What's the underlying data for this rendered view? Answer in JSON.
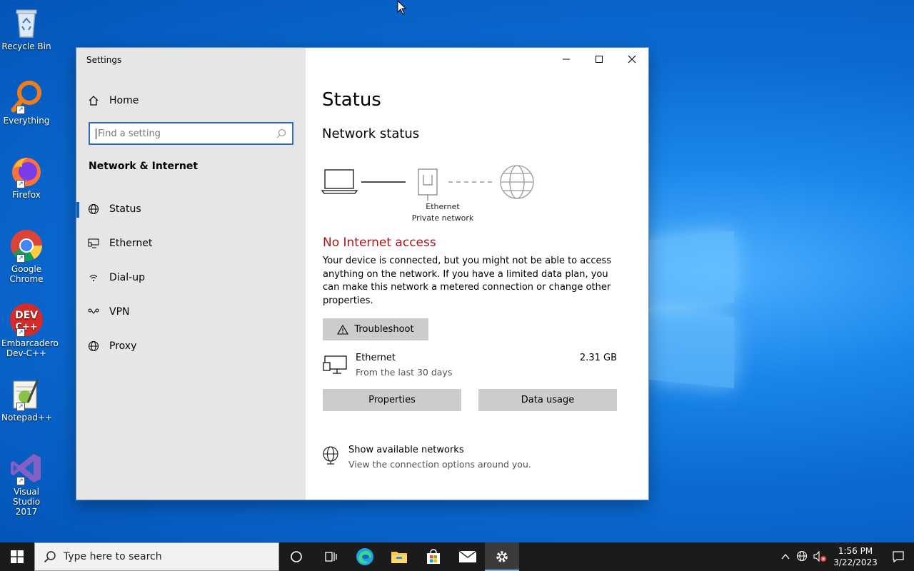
{
  "desktop": {
    "icons": [
      {
        "label": "Recycle Bin",
        "icon": "recycle-bin-icon"
      },
      {
        "label": "Everything",
        "icon": "everything-search-icon"
      },
      {
        "label": "Firefox",
        "icon": "firefox-icon"
      },
      {
        "label": "Google Chrome",
        "icon": "chrome-icon"
      },
      {
        "label": "Embarcadero Dev-C++",
        "icon": "devcpp-icon",
        "badge": "DEV C++"
      },
      {
        "label": "Notepad++",
        "icon": "notepadpp-icon"
      },
      {
        "label": "Visual Studio 2017",
        "icon": "visual-studio-icon"
      }
    ]
  },
  "window": {
    "title": "Settings",
    "caption": {
      "minimize": "minimize-icon",
      "maximize": "maximize-icon",
      "close": "close-icon"
    }
  },
  "sidebar": {
    "home_label": "Home",
    "search_placeholder": "Find a setting",
    "section_title": "Network & Internet",
    "items": [
      {
        "label": "Status",
        "icon": "globe-status-icon",
        "active": true
      },
      {
        "label": "Ethernet",
        "icon": "ethernet-icon"
      },
      {
        "label": "Dial-up",
        "icon": "dialup-icon"
      },
      {
        "label": "VPN",
        "icon": "vpn-icon"
      },
      {
        "label": "Proxy",
        "icon": "globe-icon"
      }
    ]
  },
  "main": {
    "title": "Status",
    "network_status_heading": "Network status",
    "diagram": {
      "adapter_name": "Ethernet",
      "network_type": "Private network"
    },
    "alert_title": "No Internet access",
    "description": "Your device is connected, but you might not be able to access anything on the network. If you have a limited data plan, you can make this network a metered connection or change other properties.",
    "troubleshoot_label": "Troubleshoot",
    "ethernet": {
      "name": "Ethernet",
      "subtitle": "From the last 30 days",
      "usage": "2.31 GB"
    },
    "properties_label": "Properties",
    "data_usage_label": "Data usage",
    "available": {
      "title": "Show available networks",
      "subtitle": "View the connection options around you."
    }
  },
  "taskbar": {
    "search_placeholder": "Type here to search",
    "apps": [
      "cortana-icon",
      "task-view-icon",
      "edge-icon",
      "file-explorer-icon",
      "store-icon",
      "mail-icon",
      "settings-icon"
    ],
    "clock_time": "1:56 PM",
    "clock_date": "3/22/2023"
  },
  "colors": {
    "accent": "#0a62c9",
    "alert": "#b01116",
    "sidebar": "#e6e6e6",
    "button": "#cccccc"
  }
}
